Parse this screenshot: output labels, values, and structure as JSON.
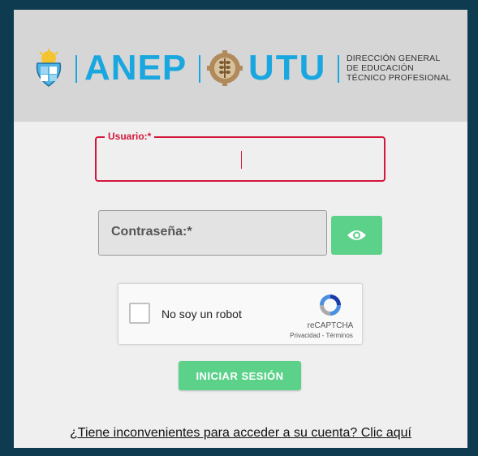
{
  "header": {
    "brand_anep": "ANEP",
    "brand_utu": "UTU",
    "org_line1": "DIRECCIÓN GENERAL",
    "org_line2": "DE EDUCACIÓN",
    "org_line3": "TÉCNICO PROFESIONAL"
  },
  "form": {
    "user_label": "Usuario:*",
    "user_value": "",
    "password_placeholder": "Contraseña:*",
    "show_password_icon": "eye-icon",
    "captcha_label": "No soy un robot",
    "captcha_brand": "reCAPTCHA",
    "captcha_links": "Privacidad - Términos",
    "login_button": "INICIAR SESIÓN",
    "help_link": "¿Tiene inconvenientes para acceder a su cuenta? Clic aquí"
  },
  "colors": {
    "background": "#0e3b4f",
    "accent_blue": "#1aa7e0",
    "accent_green": "#5cd18a",
    "error_red": "#d4163c",
    "header_bg": "#d6d6d6"
  }
}
